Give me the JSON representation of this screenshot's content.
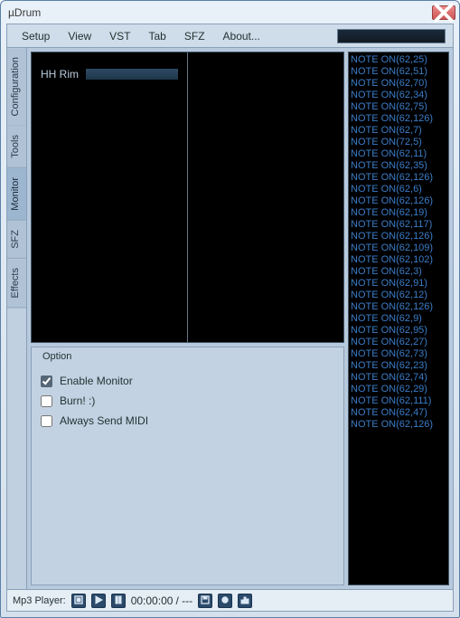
{
  "window": {
    "title": "µDrum"
  },
  "menu": {
    "items": [
      "Setup",
      "View",
      "VST",
      "Tab",
      "SFZ",
      "About..."
    ]
  },
  "side_tabs": {
    "items": [
      "Configuration",
      "Tools",
      "Monitor",
      "SFZ",
      "Effects"
    ],
    "active_index": 2
  },
  "monitor": {
    "hit_label": "HH Rim"
  },
  "options": {
    "group_label": "Option",
    "items": [
      {
        "label": "Enable Monitor",
        "checked": true
      },
      {
        "label": "Burn! :)",
        "checked": false
      },
      {
        "label": "Always Send MIDI",
        "checked": false
      }
    ]
  },
  "events": [
    "NOTE ON(62,25)",
    "NOTE ON(62,51)",
    "NOTE ON(62,70)",
    "NOTE ON(62,34)",
    "NOTE ON(62,75)",
    "NOTE ON(62,126)",
    "NOTE ON(62,7)",
    "NOTE ON(72,5)",
    "NOTE ON(62,11)",
    "NOTE ON(62,35)",
    "NOTE ON(62,126)",
    "NOTE ON(62,6)",
    "NOTE ON(62,126)",
    "NOTE ON(62,19)",
    "NOTE ON(62,117)",
    "NOTE ON(62,126)",
    "NOTE ON(62,109)",
    "NOTE ON(62,102)",
    "NOTE ON(62,3)",
    "NOTE ON(62,91)",
    "NOTE ON(62,12)",
    "NOTE ON(62,126)",
    "NOTE ON(62,9)",
    "NOTE ON(62,95)",
    "NOTE ON(62,27)",
    "NOTE ON(62,73)",
    "NOTE ON(62,23)",
    "NOTE ON(62,74)",
    "NOTE ON(62,29)",
    "NOTE ON(62,111)",
    "NOTE ON(62,47)",
    "NOTE ON(62,126)"
  ],
  "player": {
    "label": "Mp3 Player:",
    "time": "00:00:00",
    "total": "---"
  }
}
